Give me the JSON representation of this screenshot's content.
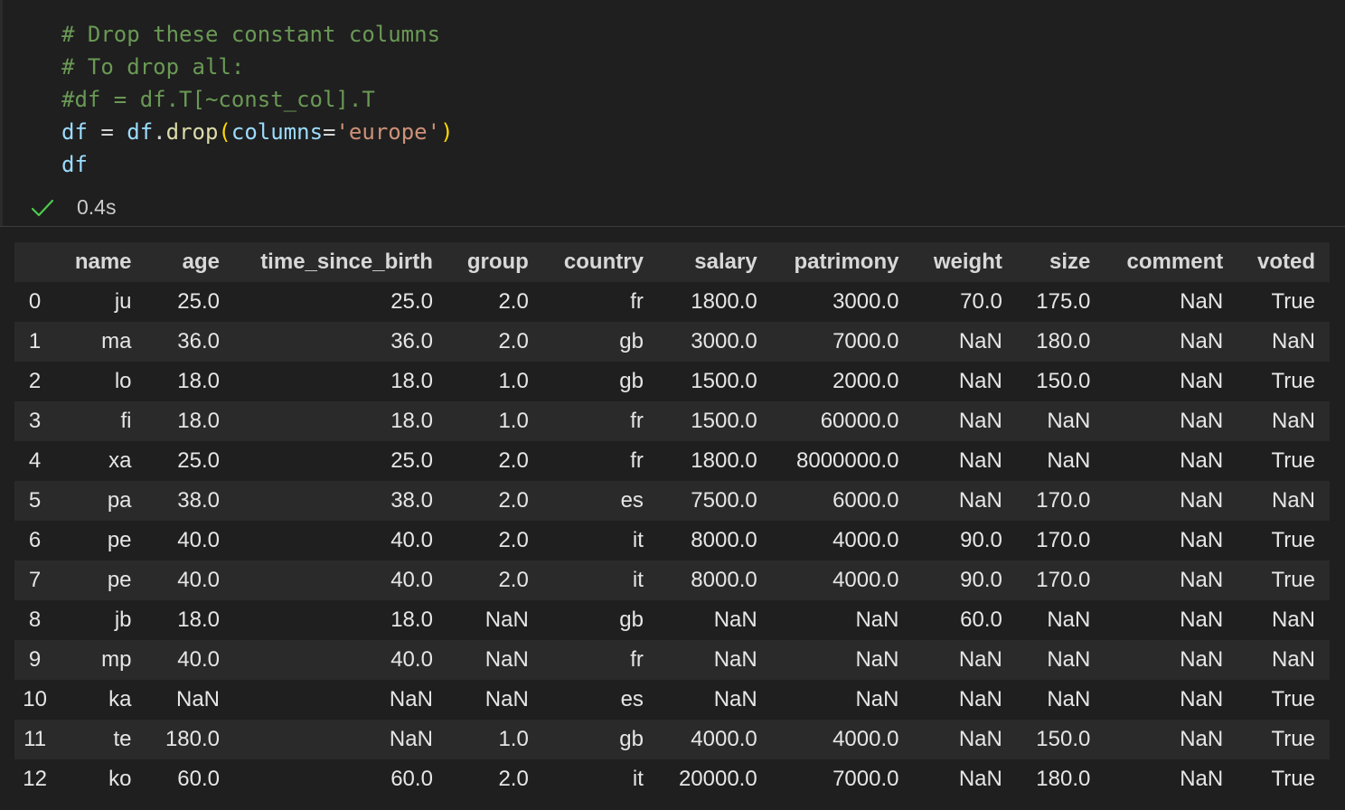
{
  "code_lines": [
    [
      {
        "t": "# Drop these constant columns",
        "c": "comment"
      }
    ],
    [
      {
        "t": "# To drop all:",
        "c": "comment"
      }
    ],
    [
      {
        "t": "#df = df.T[~const_col].T",
        "c": "comment"
      }
    ],
    [
      {
        "t": "df",
        "c": "var"
      },
      {
        "t": " = ",
        "c": "op"
      },
      {
        "t": "df",
        "c": "var"
      },
      {
        "t": ".",
        "c": "op"
      },
      {
        "t": "drop",
        "c": "fn"
      },
      {
        "t": "(",
        "c": "paren"
      },
      {
        "t": "columns",
        "c": "param"
      },
      {
        "t": "=",
        "c": "op"
      },
      {
        "t": "'europe'",
        "c": "str"
      },
      {
        "t": ")",
        "c": "paren"
      }
    ],
    [
      {
        "t": "df",
        "c": "var"
      }
    ]
  ],
  "status": {
    "icon": "check-icon",
    "time": "0.4s",
    "color": "#4ec94e"
  },
  "table": {
    "columns": [
      "",
      "name",
      "age",
      "time_since_birth",
      "group",
      "country",
      "salary",
      "patrimony",
      "weight",
      "size",
      "comment",
      "voted"
    ],
    "rows": [
      [
        "0",
        "ju",
        "25.0",
        "25.0",
        "2.0",
        "fr",
        "1800.0",
        "3000.0",
        "70.0",
        "175.0",
        "NaN",
        "True"
      ],
      [
        "1",
        "ma",
        "36.0",
        "36.0",
        "2.0",
        "gb",
        "3000.0",
        "7000.0",
        "NaN",
        "180.0",
        "NaN",
        "NaN"
      ],
      [
        "2",
        "lo",
        "18.0",
        "18.0",
        "1.0",
        "gb",
        "1500.0",
        "2000.0",
        "NaN",
        "150.0",
        "NaN",
        "True"
      ],
      [
        "3",
        "fi",
        "18.0",
        "18.0",
        "1.0",
        "fr",
        "1500.0",
        "60000.0",
        "NaN",
        "NaN",
        "NaN",
        "NaN"
      ],
      [
        "4",
        "xa",
        "25.0",
        "25.0",
        "2.0",
        "fr",
        "1800.0",
        "8000000.0",
        "NaN",
        "NaN",
        "NaN",
        "True"
      ],
      [
        "5",
        "pa",
        "38.0",
        "38.0",
        "2.0",
        "es",
        "7500.0",
        "6000.0",
        "NaN",
        "170.0",
        "NaN",
        "NaN"
      ],
      [
        "6",
        "pe",
        "40.0",
        "40.0",
        "2.0",
        "it",
        "8000.0",
        "4000.0",
        "90.0",
        "170.0",
        "NaN",
        "True"
      ],
      [
        "7",
        "pe",
        "40.0",
        "40.0",
        "2.0",
        "it",
        "8000.0",
        "4000.0",
        "90.0",
        "170.0",
        "NaN",
        "True"
      ],
      [
        "8",
        "jb",
        "18.0",
        "18.0",
        "NaN",
        "gb",
        "NaN",
        "NaN",
        "60.0",
        "NaN",
        "NaN",
        "NaN"
      ],
      [
        "9",
        "mp",
        "40.0",
        "40.0",
        "NaN",
        "fr",
        "NaN",
        "NaN",
        "NaN",
        "NaN",
        "NaN",
        "NaN"
      ],
      [
        "10",
        "ka",
        "NaN",
        "NaN",
        "NaN",
        "es",
        "NaN",
        "NaN",
        "NaN",
        "NaN",
        "NaN",
        "True"
      ],
      [
        "11",
        "te",
        "180.0",
        "NaN",
        "1.0",
        "gb",
        "4000.0",
        "4000.0",
        "NaN",
        "150.0",
        "NaN",
        "True"
      ],
      [
        "12",
        "ko",
        "60.0",
        "60.0",
        "2.0",
        "it",
        "20000.0",
        "7000.0",
        "NaN",
        "180.0",
        "NaN",
        "True"
      ]
    ]
  }
}
